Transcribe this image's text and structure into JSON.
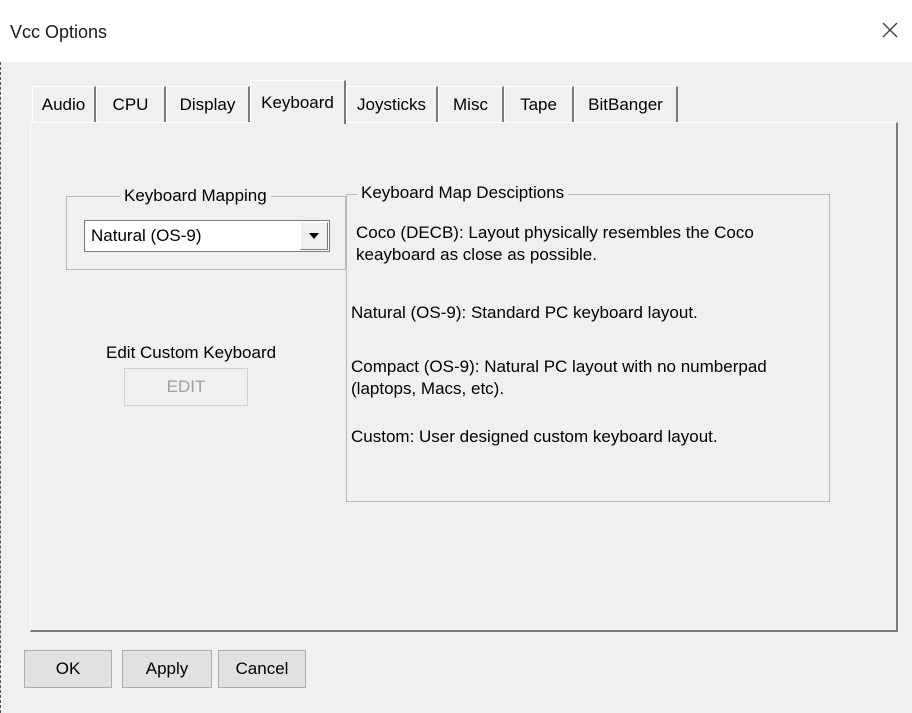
{
  "window": {
    "title": "Vcc Options"
  },
  "tabs": [
    {
      "label": "Audio"
    },
    {
      "label": "CPU"
    },
    {
      "label": "Display"
    },
    {
      "label": "Keyboard",
      "active": true
    },
    {
      "label": "Joysticks"
    },
    {
      "label": "Misc"
    },
    {
      "label": "Tape"
    },
    {
      "label": "BitBanger"
    }
  ],
  "keyboard": {
    "mapping_label": "Keyboard Mapping",
    "mapping_value": "Natural (OS-9)",
    "edit_label": "Edit Custom Keyboard",
    "edit_button": "EDIT",
    "desc_title": "Keyboard Map Desciptions",
    "descriptions": [
      "Coco (DECB): Layout physically resembles the Coco keayboard as close as possible.",
      "Natural (OS-9): Standard PC keyboard layout.",
      "Compact (OS-9): Natural PC layout with no numberpad (laptops, Macs, etc).",
      "Custom: User designed custom keyboard layout."
    ]
  },
  "footer": {
    "ok": "OK",
    "apply": "Apply",
    "cancel": "Cancel"
  },
  "icons": {
    "close": "close-icon",
    "dropdown": "chevron-down-icon"
  },
  "colors": {
    "window_bg": "#f0f0f0",
    "titlebar_bg": "#ffffff",
    "border_dark": "#7a7a7a"
  }
}
